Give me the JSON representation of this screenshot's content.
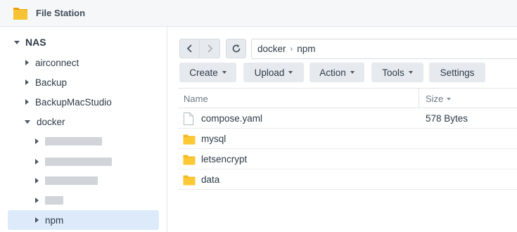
{
  "app": {
    "title": "File Station"
  },
  "sidebar": {
    "root": "NAS",
    "items": [
      {
        "label": "airconnect"
      },
      {
        "label": "Backup"
      },
      {
        "label": "BackupMacStudio"
      },
      {
        "label": "docker"
      }
    ],
    "children": [
      {
        "label": ""
      },
      {
        "label": ""
      },
      {
        "label": ""
      },
      {
        "label": ""
      },
      {
        "label": "npm"
      }
    ]
  },
  "path": {
    "segments": [
      "docker",
      "npm"
    ]
  },
  "toolbar": {
    "create": "Create",
    "upload": "Upload",
    "action": "Action",
    "tools": "Tools",
    "settings": "Settings"
  },
  "list": {
    "columns": {
      "name": "Name",
      "size": "Size"
    },
    "rows": [
      {
        "name": "compose.yaml",
        "size": "578 Bytes",
        "type": "file-icon"
      },
      {
        "name": "mysql",
        "size": "",
        "type": "folder-icon"
      },
      {
        "name": "letsencrypt",
        "size": "",
        "type": "folder-icon"
      },
      {
        "name": "data",
        "size": "",
        "type": "folder-icon"
      }
    ]
  },
  "colors": {
    "folder": "#f5b921",
    "selection": "#ddeafa",
    "button_bg": "#e6eaee"
  }
}
